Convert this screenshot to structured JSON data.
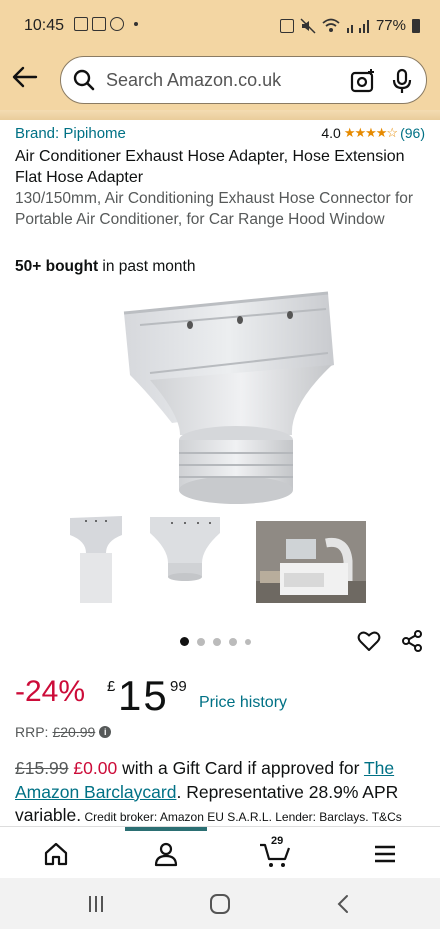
{
  "status_bar": {
    "time": "10:45",
    "battery": "77%"
  },
  "search": {
    "placeholder": "Search Amazon.co.uk"
  },
  "product": {
    "brand": "Brand: Pipihome",
    "rating": "4.0",
    "stars_filled": 4,
    "rating_count": "(96)",
    "title": "Air Conditioner Exhaust Hose Adapter, Hose Extension Flat Hose Adapter",
    "subtitle": "130/150mm, Air Conditioning Exhaust Hose Connector for Portable Air Conditioner, for Car Range Hood Window",
    "bought_bold": "50+ bought",
    "bought_rest": " in past month"
  },
  "gallery": {
    "thumbnail_count": 3,
    "dots_count": 5,
    "active_dot": 0
  },
  "price": {
    "discount": "-24%",
    "currency": "£",
    "whole": "15",
    "fraction": "99",
    "price_history": "Price history",
    "rrp_label": "RRP:",
    "rrp_value": "£20.99"
  },
  "offer": {
    "old_price": "£15.99",
    "new_price": "£0.00",
    "text_1": " with a Gift Card if approved for ",
    "card_link": "The Amazon Barclaycard",
    "text_2": ". Representative 28.9% APR variable.",
    "fine_print": " Credit broker: Amazon EU S.A.R.L. Lender: Barclays. T&Cs"
  },
  "bottom_nav": {
    "cart_count": "29",
    "items": [
      "home-icon",
      "account-icon",
      "cart-icon",
      "menu-icon"
    ],
    "active_index": 1
  },
  "colors": {
    "header_bg": "#f3d6a3",
    "link": "#007185",
    "deal_red": "#cc0c39",
    "star": "#e68a00",
    "nav_indicator": "#2b6f73"
  }
}
